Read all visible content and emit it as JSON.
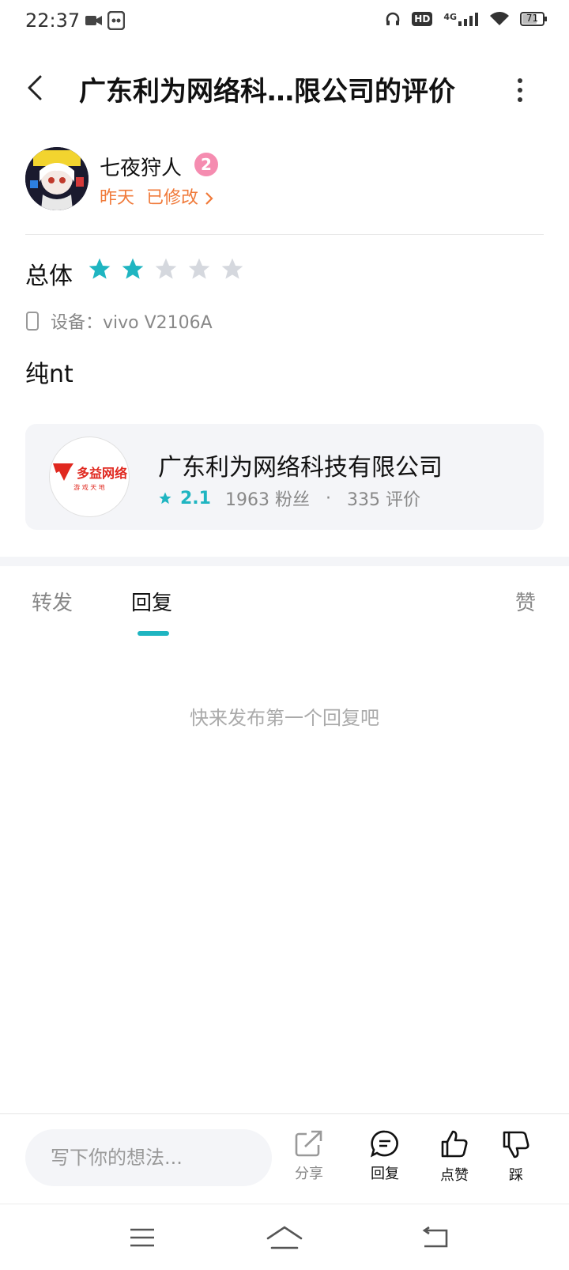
{
  "status_bar": {
    "time": "22:37",
    "network": "4G",
    "hd": "HD",
    "battery": "71"
  },
  "header": {
    "title": "广东利为网络科…限公司的评价"
  },
  "review": {
    "user_name": "七夜狩人",
    "level": "2",
    "date": "昨天",
    "edited": "已修改",
    "rating_label": "总体",
    "rating": 2,
    "max_rating": 5,
    "device": "设备：vivo  V2106A",
    "content": "纯nt"
  },
  "app_card": {
    "logo_text": "多益网络",
    "logo_subtext": "游 戏 天 地",
    "name": "广东利为网络科技有限公司",
    "score": "2.1",
    "fans": "1963  粉丝",
    "dot": "·",
    "reviews": "335  评价"
  },
  "tabs": [
    {
      "label": "转发"
    },
    {
      "label": "回复"
    },
    {
      "label": "赞"
    }
  ],
  "empty_state": "快来发布第一个回复吧",
  "bottom_bar": {
    "input_placeholder": "写下你的想法...",
    "share": "分享",
    "reply": "回复",
    "like": "点赞",
    "dislike": "踩"
  },
  "colors": {
    "accent": "#1fb5c1",
    "orange": "#f07a3a",
    "star_empty": "#d5d8de",
    "brand_red": "#e0281f"
  }
}
